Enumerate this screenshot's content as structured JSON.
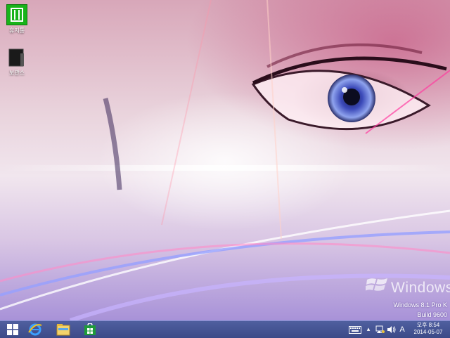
{
  "desktop": {
    "icons": [
      {
        "label": "휴지통",
        "icon": "recycle-bin-icon"
      },
      {
        "label": "보관스",
        "icon": "box-app-icon"
      }
    ],
    "watermark": {
      "logo": "windows-flag-icon",
      "brand": "Windows",
      "edition": "Windows 8.1 Pro K",
      "build": "Build 9600"
    }
  },
  "taskbar": {
    "pinned": [
      {
        "name": "Start",
        "icon": "windows-start-icon"
      },
      {
        "name": "Internet Explorer",
        "icon": "internet-explorer-icon"
      },
      {
        "name": "File Explorer",
        "icon": "file-explorer-icon"
      },
      {
        "name": "Store",
        "icon": "store-icon"
      }
    ],
    "tray": {
      "keyboard_icon": "touch-keyboard-icon",
      "overflow_glyph": "▴",
      "network_icon": "network-icon",
      "volume_icon": "volume-icon",
      "ime": "A",
      "time": "오후 8:54",
      "date": "2014-05-07"
    }
  },
  "colors": {
    "taskbar": "#3c4a88",
    "recycle_green": "#18b31a"
  }
}
